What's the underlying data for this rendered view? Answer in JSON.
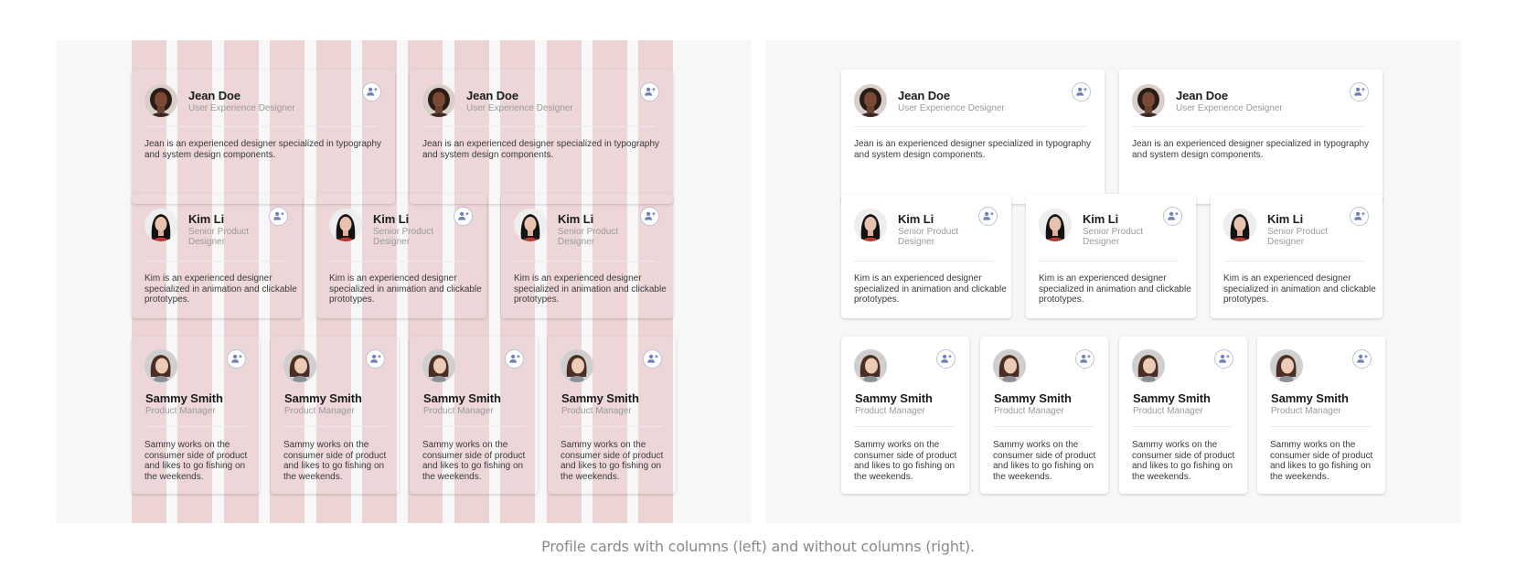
{
  "caption": "Profile cards with columns (left) and without columns (right).",
  "colors": {
    "column_guide": "#ecd3d4",
    "panel_background": "#f7f7f7",
    "card_background": "#ffffff",
    "add_icon": "#6f7fbf"
  },
  "icons": {
    "add_button": "add-person-icon",
    "avatar": "avatar-photo"
  },
  "cards": {
    "jean": {
      "name": "Jean Doe",
      "role": "User Experience Designer",
      "description": "Jean is an experienced designer specialized in typography and system design components."
    },
    "kim": {
      "name": "Kim Li",
      "role": "Senior Product Designer",
      "description": "Kim is an experienced designer specialized in animation and clickable prototypes."
    },
    "sammy": {
      "name": "Sammy Smith",
      "role": "Product Manager",
      "description": "Sammy works on the consumer side of product and likes to go fishing on the weekends."
    }
  }
}
